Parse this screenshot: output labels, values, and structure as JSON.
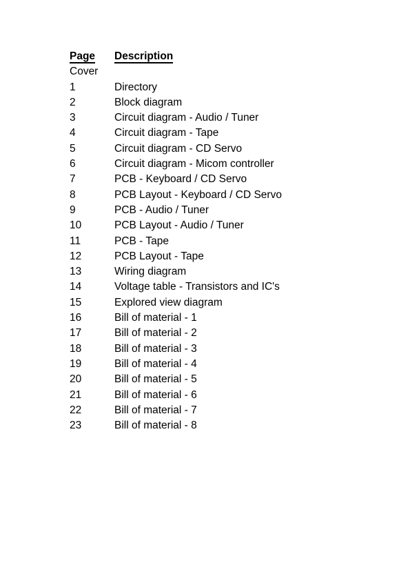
{
  "document": {
    "type": "table-of-contents",
    "background_color": "#ffffff",
    "text_color": "#000000"
  },
  "table": {
    "headers": {
      "page": "Page",
      "description": "Description"
    },
    "rows": [
      {
        "page": "Cover",
        "description": ""
      },
      {
        "page": "1",
        "description": "Directory"
      },
      {
        "page": "2",
        "description": "Block diagram"
      },
      {
        "page": "3",
        "description": "Circuit diagram - Audio / Tuner"
      },
      {
        "page": "4",
        "description": "Circuit diagram - Tape"
      },
      {
        "page": "5",
        "description": "Circuit diagram - CD Servo"
      },
      {
        "page": "6",
        "description": "Circuit diagram - Micom controller"
      },
      {
        "page": "7",
        "description": "PCB - Keyboard / CD Servo"
      },
      {
        "page": "8",
        "description": "PCB Layout - Keyboard / CD Servo"
      },
      {
        "page": "9",
        "description": "PCB - Audio / Tuner"
      },
      {
        "page": "10",
        "description": "PCB Layout - Audio / Tuner"
      },
      {
        "page": "11",
        "description": "PCB - Tape"
      },
      {
        "page": "12",
        "description": "PCB Layout - Tape"
      },
      {
        "page": "13",
        "description": "Wiring diagram"
      },
      {
        "page": "14",
        "description": "Voltage table - Transistors and IC's"
      },
      {
        "page": "15",
        "description": "Explored view diagram"
      },
      {
        "page": "16",
        "description": "Bill of material - 1"
      },
      {
        "page": "17",
        "description": "Bill of material - 2"
      },
      {
        "page": "18",
        "description": "Bill of material - 3"
      },
      {
        "page": "19",
        "description": "Bill of material - 4"
      },
      {
        "page": "20",
        "description": "Bill of material - 5"
      },
      {
        "page": "21",
        "description": "Bill of material - 6"
      },
      {
        "page": "22",
        "description": "Bill of material - 7"
      },
      {
        "page": "23",
        "description": "Bill of material - 8"
      }
    ]
  }
}
